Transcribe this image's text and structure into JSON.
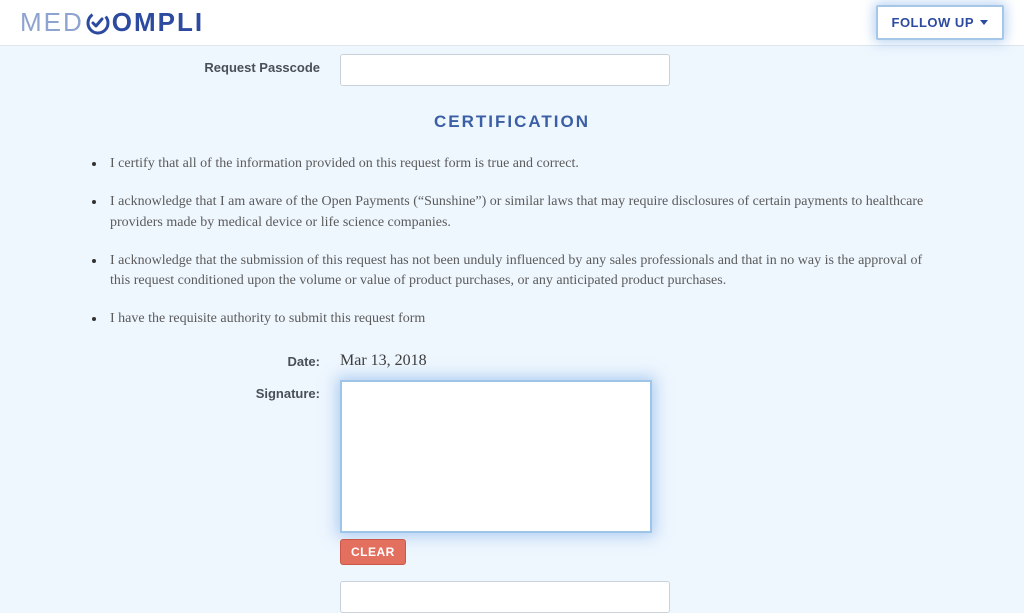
{
  "header": {
    "logo_pre": "MED",
    "logo_post": "OMPLI",
    "followup_label": "FOLLOW UP"
  },
  "form": {
    "passcode_label": "Request Passcode",
    "passcode_value": ""
  },
  "section_title": "CERTIFICATION",
  "certifications": [
    "I certify that all of the information provided on this request form is true and correct.",
    "I acknowledge that I am aware of the Open Payments (“Sunshine”) or similar laws that may require disclosures of certain payments to healthcare providers made by medical device or life science companies.",
    "I acknowledge that the submission of this request has not been unduly influenced by any sales professionals and that in no way is the approval of this request conditioned upon the volume or value of product purchases, or any anticipated product purchases.",
    "I have the requisite authority to submit this request form"
  ],
  "date_label": "Date:",
  "date_value": "Mar 13, 2018",
  "signature_label": "Signature:",
  "clear_label": "CLEAR"
}
